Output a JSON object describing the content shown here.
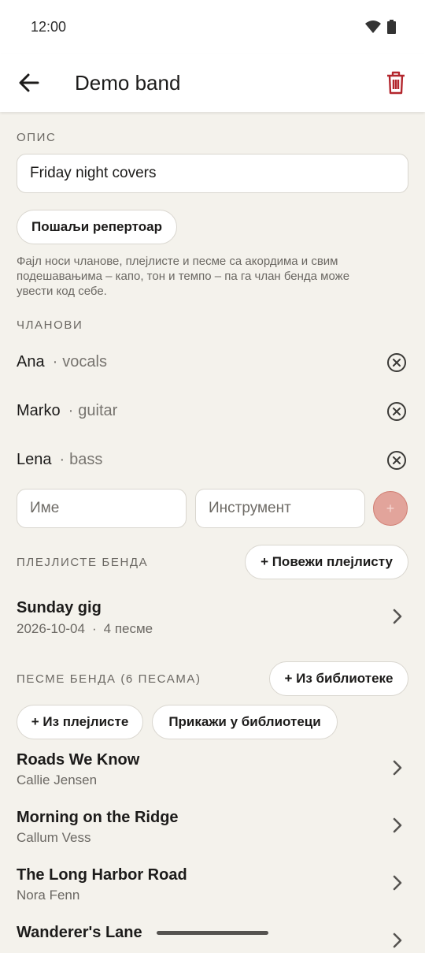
{
  "status_bar": {
    "time": "12:00"
  },
  "app_bar": {
    "title": "Demo band"
  },
  "description": {
    "section_label": "ОПИС",
    "value": "Friday night covers",
    "send_button": "Пошаљи репертоар",
    "note": "Фајл носи чланове, плејлисте и песме са акордима и свим подешавањима – капо, тон и темпо – па га члан бенда може увести код себе."
  },
  "members": {
    "section_label": "ЧЛАНОВИ",
    "items": [
      {
        "name": "Ana",
        "instrument": "vocals"
      },
      {
        "name": "Marko",
        "instrument": "guitar"
      },
      {
        "name": "Lena",
        "instrument": "bass"
      }
    ],
    "name_placeholder": "Име",
    "instrument_placeholder": "Инструмент",
    "add_label": "+"
  },
  "playlists": {
    "section_label": "ПЛЕЈЛИСТЕ БЕНДА",
    "link_button": "+ Повежи плејлисту",
    "items": [
      {
        "title": "Sunday gig",
        "date": "2026-10-04",
        "sep": "·",
        "count": "4 песме"
      }
    ]
  },
  "songs": {
    "section_label": "ПЕСМЕ БЕНДА (6 ПЕСАМА)",
    "from_library_button": "+ Из библиотеке",
    "from_playlist_button": "+ Из плејлисте",
    "show_in_library_button": "Прикажи у библиотеци",
    "items": [
      {
        "title": "Roads We Know",
        "artist": "Callie Jensen"
      },
      {
        "title": "Morning on the Ridge",
        "artist": "Callum Vess"
      },
      {
        "title": "The Long Harbor Road",
        "artist": "Nora Fenn"
      },
      {
        "title": "Wanderer's Lane",
        "artist": ""
      }
    ]
  },
  "colors": {
    "accent": "#b3262d",
    "background": "#f4f2ec",
    "add_button": "#e2a49b"
  }
}
